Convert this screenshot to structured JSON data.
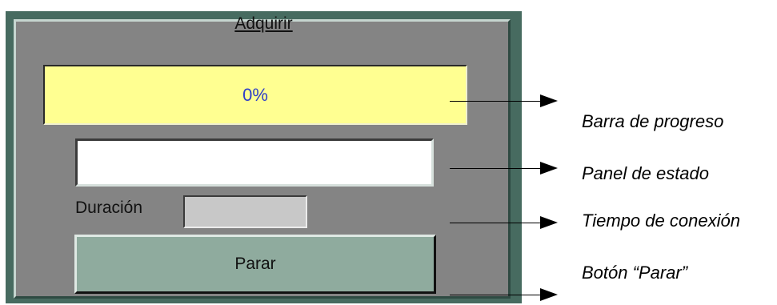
{
  "dialog": {
    "title": "Adquirir",
    "progress": {
      "percent": 0,
      "label": "0%",
      "color": "#ffff91",
      "text_color": "#2f3fc8"
    },
    "status_panel": {
      "value": ""
    },
    "duration": {
      "label": "Duración",
      "value": ""
    },
    "stop_button": {
      "label": "Parar",
      "color": "#8fab9e"
    }
  },
  "annotations": [
    {
      "label": "Barra de progreso"
    },
    {
      "label": "Panel de estado"
    },
    {
      "label": "Tiempo de conexión"
    },
    {
      "label": "Botón “Parar”"
    }
  ]
}
